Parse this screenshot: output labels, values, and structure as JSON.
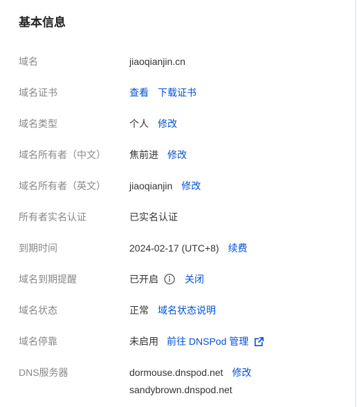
{
  "title": "基本信息",
  "rows": {
    "domain": {
      "label": "域名",
      "value": "jiaoqianjin.cn"
    },
    "cert": {
      "label": "域名证书",
      "view": "查看",
      "download": "下载证书"
    },
    "type": {
      "label": "域名类型",
      "value": "个人",
      "edit": "修改"
    },
    "owner_cn": {
      "label": "域名所有者（中文）",
      "value": "焦前进",
      "edit": "修改"
    },
    "owner_en": {
      "label": "域名所有者（英文）",
      "value": "jiaoqianjin",
      "edit": "修改"
    },
    "realname": {
      "label": "所有者实名认证",
      "value": "已实名认证"
    },
    "expiry": {
      "label": "到期时间",
      "value": "2024-02-17 (UTC+8)",
      "renew": "续费"
    },
    "reminder": {
      "label": "域名到期提醒",
      "value": "已开启",
      "close": "关闭",
      "icon": "info-circle-icon"
    },
    "status": {
      "label": "域名状态",
      "value": "正常",
      "link": "域名状态说明"
    },
    "parking": {
      "label": "域名停靠",
      "value": "未启用",
      "link": "前往 DNSPod 管理",
      "icon": "external-link-icon"
    },
    "dns": {
      "label": "DNS服务器",
      "server1": "dormouse.dnspod.net",
      "server2": "sandybrown.dnspod.net",
      "edit": "修改"
    }
  },
  "colors": {
    "link": "#0052d9",
    "label": "#888888",
    "value": "#333333",
    "title": "#1f1f1f"
  }
}
